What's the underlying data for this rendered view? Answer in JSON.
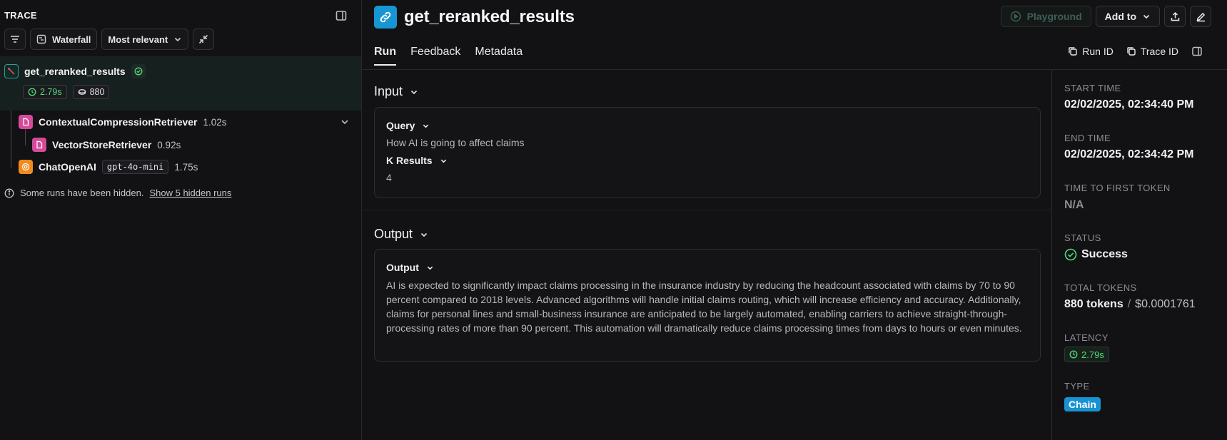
{
  "trace_panel": {
    "header": "TRACE",
    "toolbar": {
      "view": "Waterfall",
      "sort": "Most relevant"
    },
    "root": {
      "name": "get_reranked_results",
      "latency": "2.79s",
      "tokens": "880"
    },
    "children": [
      {
        "name": "ContextualCompressionRetriever",
        "time": "1.02s"
      },
      {
        "name": "VectorStoreRetriever",
        "time": "0.92s"
      },
      {
        "name": "ChatOpenAI",
        "model": "gpt-4o-mini",
        "time": "1.75s"
      }
    ],
    "hidden_note": "Some runs have been hidden.",
    "hidden_link": "Show 5 hidden runs"
  },
  "header": {
    "title": "get_reranked_results",
    "playground": "Playground",
    "add_to": "Add to"
  },
  "tabs": [
    "Run",
    "Feedback",
    "Metadata"
  ],
  "id_buttons": {
    "run_id": "Run ID",
    "trace_id": "Trace ID"
  },
  "input": {
    "section_title": "Input",
    "query_label": "Query",
    "query_value": "How AI is going to affect claims",
    "k_label": "K Results",
    "k_value": "4"
  },
  "output": {
    "section_title": "Output",
    "label": "Output",
    "text": "AI is expected to significantly impact claims processing in the insurance industry by reducing the headcount associated with claims by 70 to 90 percent compared to 2018 levels. Advanced algorithms will handle initial claims routing, which will increase efficiency and accuracy. Additionally, claims for personal lines and small-business insurance are anticipated to be largely automated, enabling carriers to achieve straight-through-processing rates of more than 90 percent. This automation will dramatically reduce claims processing times from days to hours or even minutes."
  },
  "meta": {
    "start_time_label": "START TIME",
    "start_time": "02/02/2025, 02:34:40 PM",
    "end_time_label": "END TIME",
    "end_time": "02/02/2025, 02:34:42 PM",
    "ttft_label": "TIME TO FIRST TOKEN",
    "ttft": "N/A",
    "status_label": "STATUS",
    "status": "Success",
    "tokens_label": "TOTAL TOKENS",
    "tokens": "880 tokens",
    "tokens_sep": "/",
    "cost": "$0.0001761",
    "latency_label": "LATENCY",
    "latency": "2.79s",
    "type_label": "TYPE",
    "type": "Chain"
  },
  "colors": {
    "accent_blue": "#1696d2",
    "success_green": "#4fdc7c",
    "retriever_pink": "#d64a9a",
    "openai_orange": "#f08a1c"
  }
}
